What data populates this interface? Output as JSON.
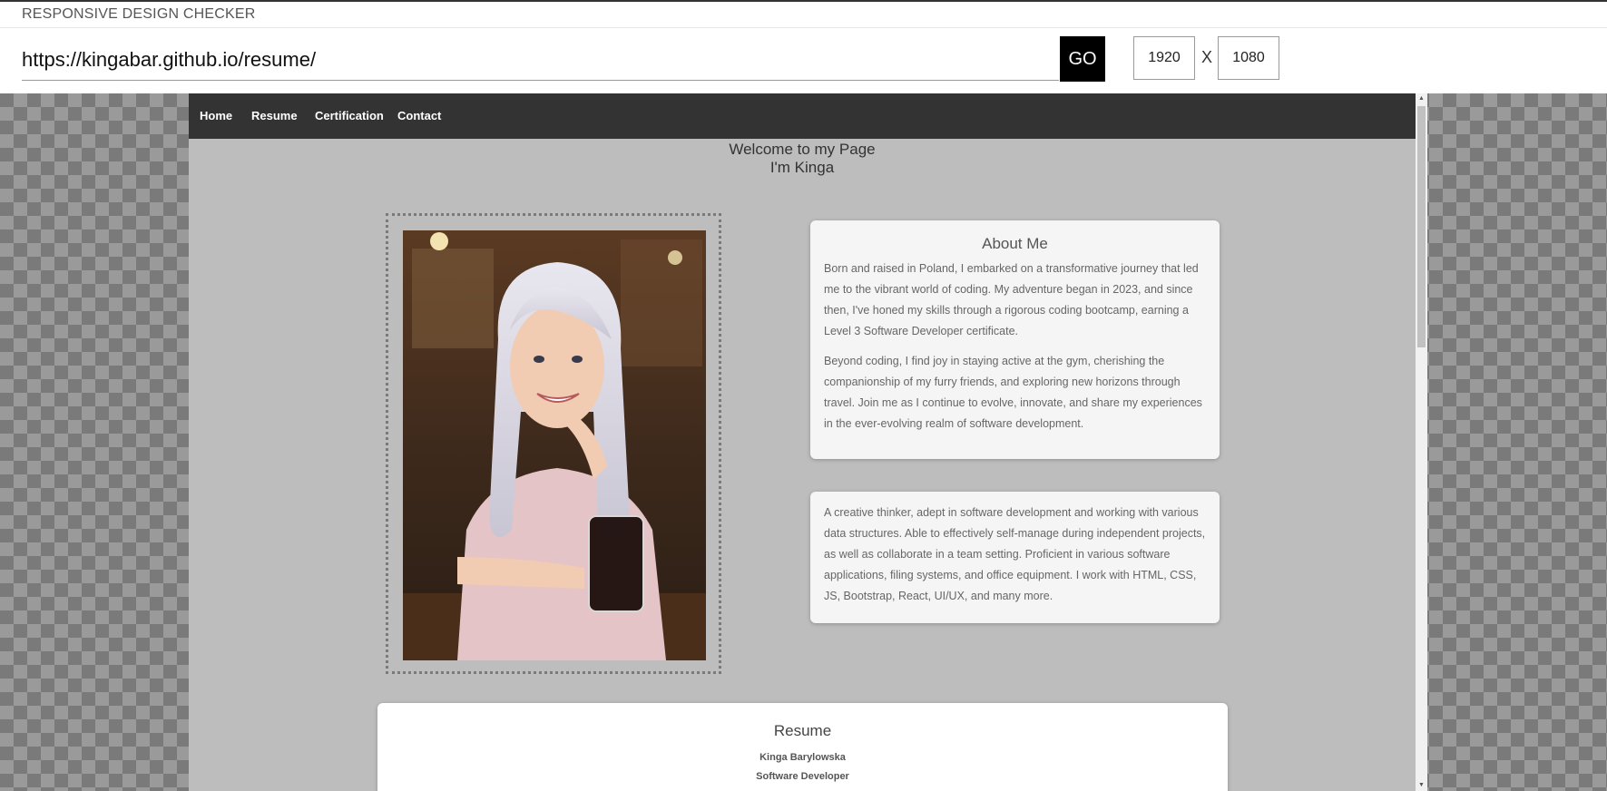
{
  "app": {
    "title": "RESPONSIVE DESIGN CHECKER"
  },
  "toolbar": {
    "url": "https://kingabar.github.io/resume/",
    "go_label": "GO",
    "width": "1920",
    "separator": "X",
    "height": "1080"
  },
  "site": {
    "nav": [
      "Home",
      "Resume",
      "Certification",
      "Contact"
    ],
    "welcome_line1": "Welcome to my Page",
    "welcome_line2": "I'm Kinga",
    "about": {
      "heading": "About Me",
      "para1": "Born and raised in Poland, I embarked on a transformative journey that led me to the vibrant world of coding. My adventure began in 2023, and since then, I've honed my skills through a rigorous coding bootcamp, earning a Level 3 Software Developer certificate.",
      "para2": "Beyond coding, I find joy in staying active at the gym, cherishing the companionship of my furry friends, and exploring new horizons through travel. Join me as I continue to evolve, innovate, and share my experiences in the ever-evolving realm of software development."
    },
    "summary": {
      "text": "A creative thinker, adept in software development and working with various data structures. Able to effectively self-manage during independent projects, as well as collaborate in a team setting. Proficient in various software applications, filing systems, and office equipment. I work with HTML, CSS, JS, Bootstrap, React, UI/UX, and many more."
    },
    "resume": {
      "heading": "Resume",
      "name": "Kinga Barylowska",
      "role": "Software Developer"
    }
  },
  "colors": {
    "nav_bg": "#333333",
    "page_bg": "#bdbdbd",
    "card_bg": "#f5f5f5",
    "go_bg": "#000000"
  }
}
